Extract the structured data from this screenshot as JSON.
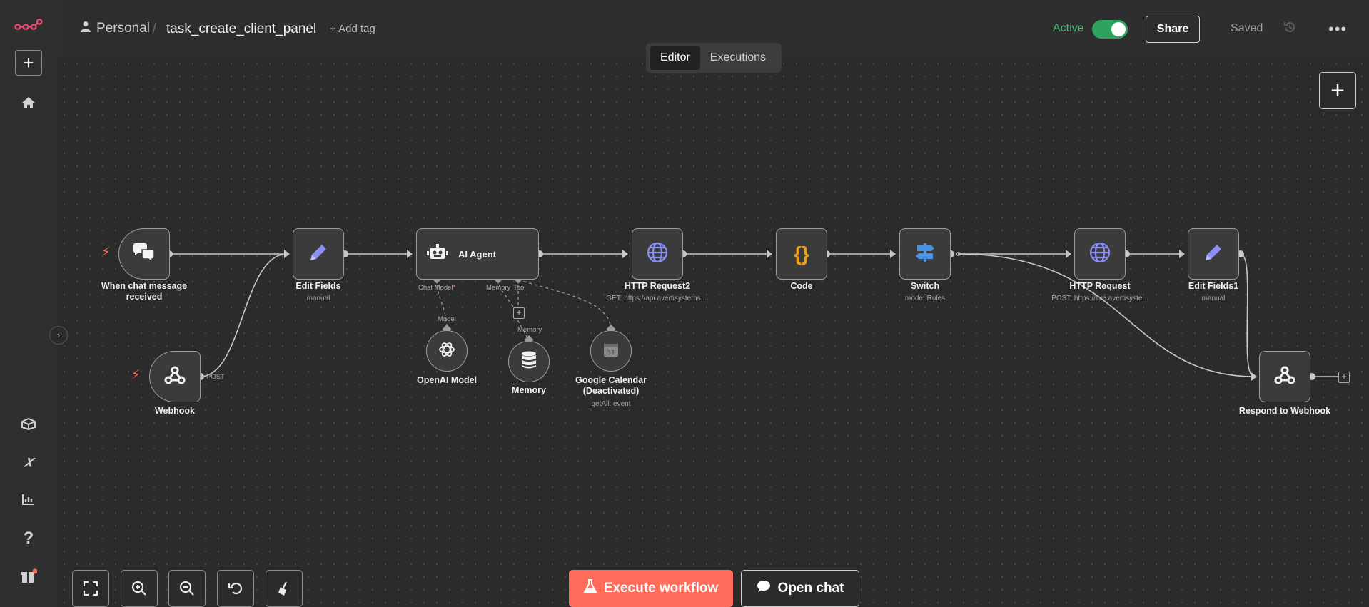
{
  "header": {
    "project": "Personal",
    "workflow_name": "task_create_client_panel",
    "add_tag": "+ Add tag",
    "active_label": "Active",
    "share_label": "Share",
    "saved_label": "Saved"
  },
  "tabs": [
    {
      "label": "Editor",
      "active": true
    },
    {
      "label": "Executions",
      "active": false
    }
  ],
  "nodes": {
    "chat_trigger": {
      "label_line1": "When chat message",
      "label_line2": "received"
    },
    "webhook": {
      "label": "Webhook",
      "port": "POST"
    },
    "edit_fields": {
      "label": "Edit Fields",
      "sub": "manual"
    },
    "ai_agent": {
      "label": "AI Agent",
      "port_chat_model": "Chat Model",
      "required_mark": "*",
      "port_memory": "Memory",
      "port_tool": "Tool"
    },
    "openai": {
      "label": "OpenAI Model",
      "port": "Model"
    },
    "memory": {
      "label": "Memory",
      "port": "Memory"
    },
    "gcal": {
      "label_line1": "Google Calendar",
      "label_line2": "(Deactivated)",
      "sub": "getAll: event"
    },
    "http2": {
      "label": "HTTP Request2",
      "sub": "GET: https://api.avertisystems...."
    },
    "code": {
      "label": "Code"
    },
    "switch": {
      "label": "Switch",
      "sub": "mode: Rules"
    },
    "http": {
      "label": "HTTP Request",
      "sub": "POST: https://live.avertisyste..."
    },
    "edit_fields1": {
      "label": "Edit Fields1",
      "sub": "manual"
    },
    "respond": {
      "label": "Respond to Webhook"
    }
  },
  "bottom": {
    "execute_label": "Execute workflow",
    "open_chat_label": "Open chat"
  },
  "colors": {
    "accent": "#ff6d5a",
    "active_green": "#2fa25f",
    "http_icon": "#8b8ff5",
    "code_icon": "#f59e0b",
    "switch_icon": "#4a90e2"
  }
}
